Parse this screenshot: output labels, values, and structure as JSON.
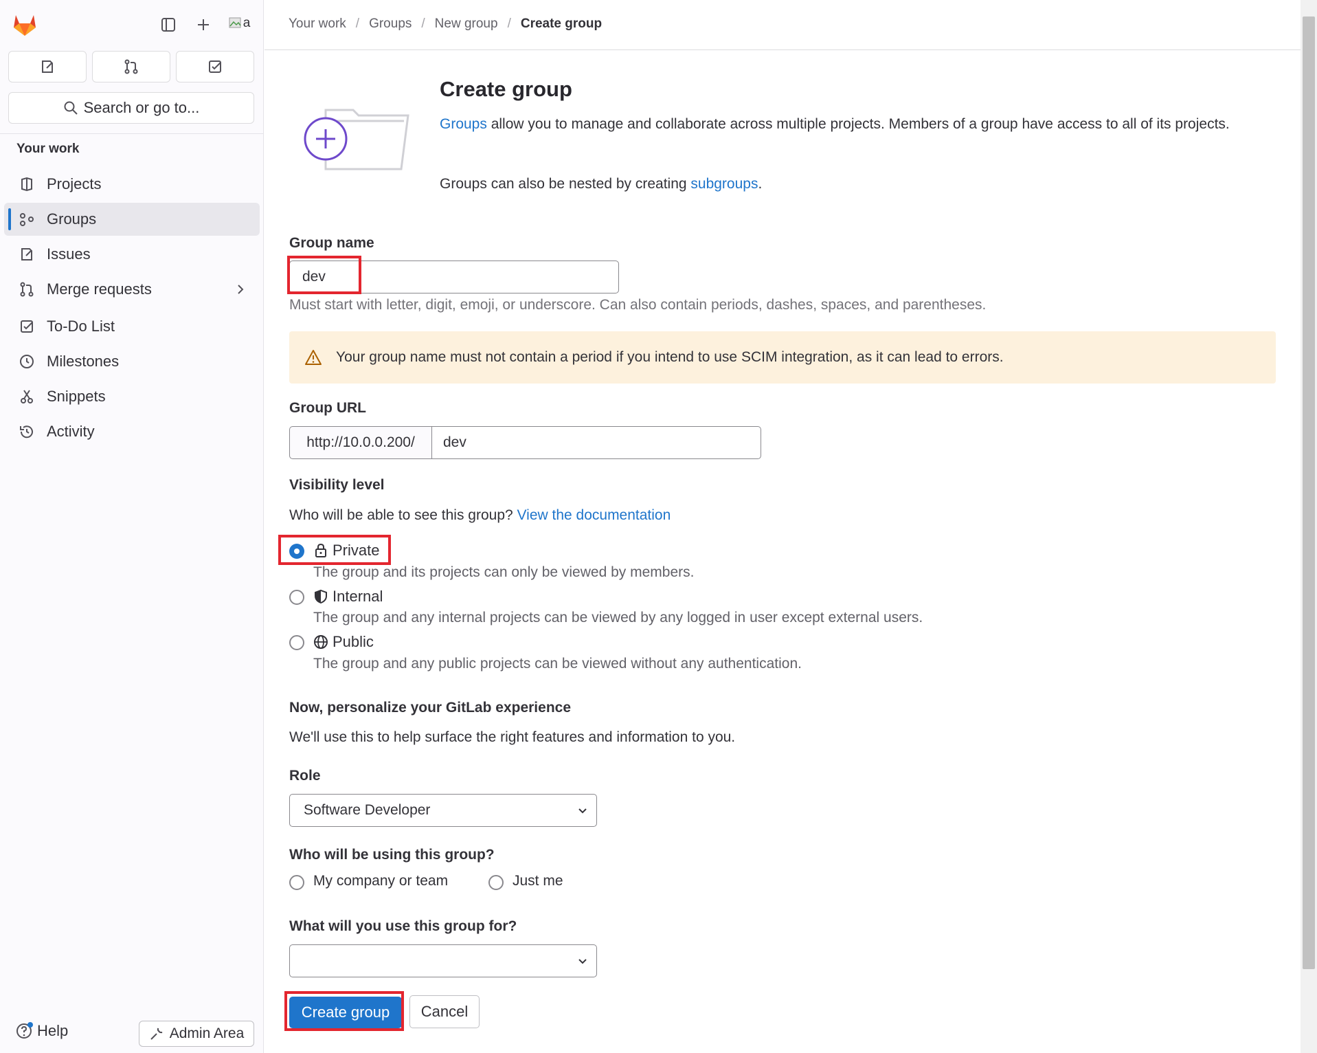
{
  "sidebar": {
    "avatar_alt": "a",
    "search_label": "Search or go to...",
    "section_title": "Your work",
    "items": [
      {
        "label": "Projects"
      },
      {
        "label": "Groups"
      },
      {
        "label": "Issues"
      },
      {
        "label": "Merge requests"
      },
      {
        "label": "To-Do List"
      },
      {
        "label": "Milestones"
      },
      {
        "label": "Snippets"
      },
      {
        "label": "Activity"
      }
    ],
    "active_item": "Groups",
    "help_label": "Help",
    "admin_label": "Admin Area"
  },
  "breadcrumb": [
    "Your work",
    "Groups",
    "New group",
    "Create group"
  ],
  "page": {
    "title": "Create group",
    "intro_link": "Groups",
    "intro_rest": " allow you to manage and collaborate across multiple projects. Members of a group have access to all of its projects.",
    "nested_text": "Groups can also be nested by creating ",
    "nested_link": "subgroups",
    "nested_end": "."
  },
  "form": {
    "group_name_label": "Group name",
    "group_name_value": "dev",
    "group_name_help": "Must start with letter, digit, emoji, or underscore. Can also contain periods, dashes, spaces, and parentheses.",
    "alert_text": "Your group name must not contain a period if you intend to use SCIM integration, as it can lead to errors.",
    "group_url_label": "Group URL",
    "group_url_prefix": "http://10.0.0.200/",
    "group_url_value": "dev",
    "visibility_label": "Visibility level",
    "visibility_question": "Who will be able to see this group? ",
    "visibility_link": "View the documentation",
    "visibility_options": [
      {
        "label": "Private",
        "description": "The group and its projects can only be viewed by members.",
        "checked": true,
        "icon": "lock-icon"
      },
      {
        "label": "Internal",
        "description": "The group and any internal projects can be viewed by any logged in user except external users.",
        "checked": false,
        "icon": "shield-icon"
      },
      {
        "label": "Public",
        "description": "The group and any public projects can be viewed without any authentication.",
        "checked": false,
        "icon": "globe-icon"
      }
    ],
    "personalize_title": "Now, personalize your GitLab experience",
    "personalize_text": "We'll use this to help surface the right features and information to you.",
    "role_label": "Role",
    "role_value": "Software Developer",
    "audience_label": "Who will be using this group?",
    "audience_options": [
      "My company or team",
      "Just me"
    ],
    "purpose_label": "What will you use this group for?",
    "purpose_value": "",
    "submit_label": "Create group",
    "cancel_label": "Cancel"
  },
  "colors": {
    "accent": "#1f75cb",
    "highlight_box": "#e3262f",
    "alert_bg": "#fdf1dd",
    "gitlab_orange": "#e24329"
  }
}
